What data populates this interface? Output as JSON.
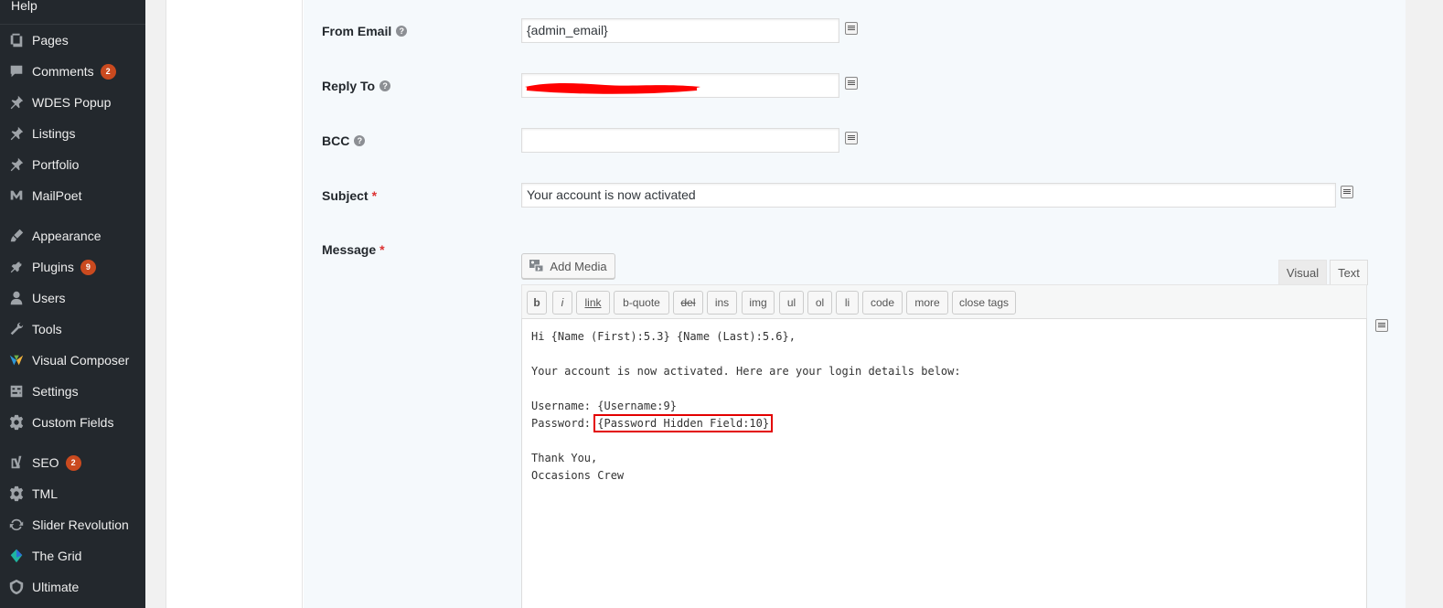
{
  "sidebar": {
    "help_label": "Help",
    "items": [
      {
        "label": "Pages",
        "icon": "pages-icon"
      },
      {
        "label": "Comments",
        "icon": "comments-icon",
        "badge": "2"
      },
      {
        "label": "WDES Popup",
        "icon": "pin-icon"
      },
      {
        "label": "Listings",
        "icon": "pin-icon"
      },
      {
        "label": "Portfolio",
        "icon": "pin-icon"
      },
      {
        "label": "MailPoet",
        "icon": "mailpoet-icon"
      },
      {
        "label": "Appearance",
        "icon": "brush-icon"
      },
      {
        "label": "Plugins",
        "icon": "plugin-icon",
        "badge": "9"
      },
      {
        "label": "Users",
        "icon": "user-icon"
      },
      {
        "label": "Tools",
        "icon": "wrench-icon"
      },
      {
        "label": "Visual Composer",
        "icon": "visual-composer-icon"
      },
      {
        "label": "Settings",
        "icon": "sliders-icon"
      },
      {
        "label": "Custom Fields",
        "icon": "gear-icon"
      },
      {
        "label": "SEO",
        "icon": "yoast-icon",
        "badge": "2"
      },
      {
        "label": "TML",
        "icon": "gear-icon"
      },
      {
        "label": "Slider Revolution",
        "icon": "refresh-icon"
      },
      {
        "label": "The Grid",
        "icon": "grid-logo-icon"
      },
      {
        "label": "Ultimate",
        "icon": "shield-icon"
      }
    ]
  },
  "form": {
    "from_email": {
      "label": "From Email",
      "value": "{admin_email}"
    },
    "reply_to": {
      "label": "Reply To",
      "value": ""
    },
    "bcc": {
      "label": "BCC",
      "value": ""
    },
    "subject": {
      "label": "Subject",
      "required": "*",
      "value": "Your account is now activated"
    },
    "message": {
      "label": "Message",
      "required": "*"
    }
  },
  "editor": {
    "add_media_label": "Add Media",
    "tabs": {
      "visual": "Visual",
      "text": "Text"
    },
    "quicktags": [
      "b",
      "i",
      "link",
      "b-quote",
      "del",
      "ins",
      "img",
      "ul",
      "ol",
      "li",
      "code",
      "more",
      "close tags"
    ],
    "content": {
      "line1": "Hi {Name (First):5.3} {Name (Last):5.6},",
      "line2": "Your account is now activated. Here are your login details below:",
      "line3": "Username: {Username:9}",
      "line4_prefix": "Password: ",
      "line4_highlight": "{Password Hidden Field:10}",
      "line5": "Thank You,",
      "line6": "Occasions Crew"
    }
  },
  "colors": {
    "sidebar_bg": "#23282d",
    "badge_bg": "#ca4a1f",
    "highlight_border": "#e30000",
    "redaction": "#ff0000"
  }
}
